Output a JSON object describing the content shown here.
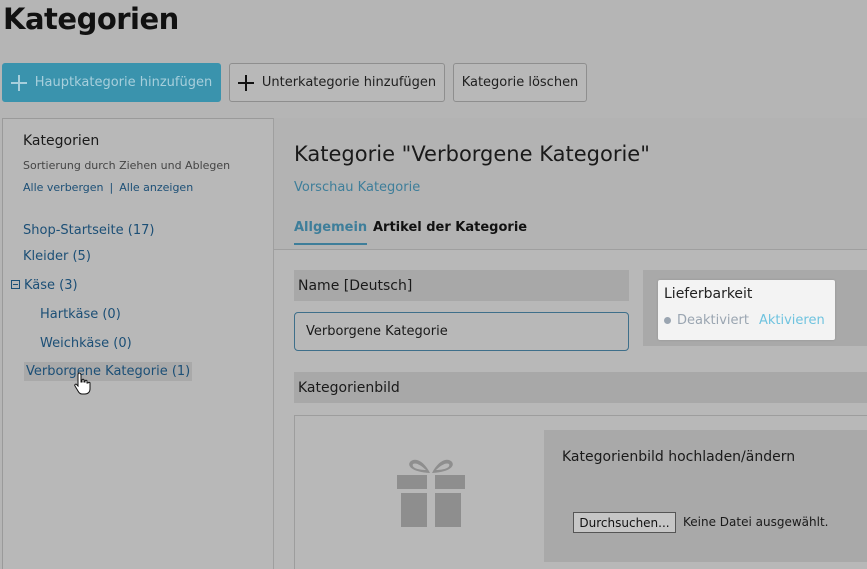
{
  "page": {
    "title": "Kategorien"
  },
  "toolbar": {
    "add_main": "Hauptkategorie hinzufügen",
    "add_sub": "Unterkategorie hinzufügen",
    "delete": "Kategorie löschen"
  },
  "sidebar": {
    "title": "Kategorien",
    "hint": "Sortierung durch Ziehen und Ablegen",
    "hide_all": "Alle verbergen",
    "separator": "|",
    "show_all": "Alle anzeigen",
    "items": [
      {
        "label": "Shop-Startseite (17)"
      },
      {
        "label": "Kleider (5)"
      },
      {
        "label": "Käse (3)",
        "expanded": true
      },
      {
        "label": "Hartkäse (0)"
      },
      {
        "label": "Weichkäse (0)"
      },
      {
        "label": "Verborgene Kategorie (1)",
        "selected": true
      }
    ]
  },
  "main": {
    "title": "Kategorie \"Verborgene Kategorie\"",
    "preview": "Vorschau Kategorie",
    "tabs": [
      {
        "label": "Allgemein",
        "active": true
      },
      {
        "label": "Artikel der Kategorie"
      }
    ],
    "name_header": "Name [Deutsch]",
    "name_value": "Verborgene Kategorie",
    "availability": {
      "title": "Lieferbarkeit",
      "status": "Deaktiviert",
      "action": "Aktivieren"
    },
    "image_header": "Kategorienbild",
    "upload_label": "Kategorienbild hochladen/ändern",
    "browse": "Durchsuchen...",
    "no_file": "Keine Datei ausgewählt."
  },
  "colors": {
    "accent": "#3a93ad",
    "link": "#1c4f76",
    "tab_active": "#3e7e9a",
    "activate": "#6fc3df"
  },
  "icons": [
    "plus-icon",
    "expander-minus-icon",
    "gift-icon",
    "hand-cursor-icon",
    "status-dot-icon"
  ]
}
